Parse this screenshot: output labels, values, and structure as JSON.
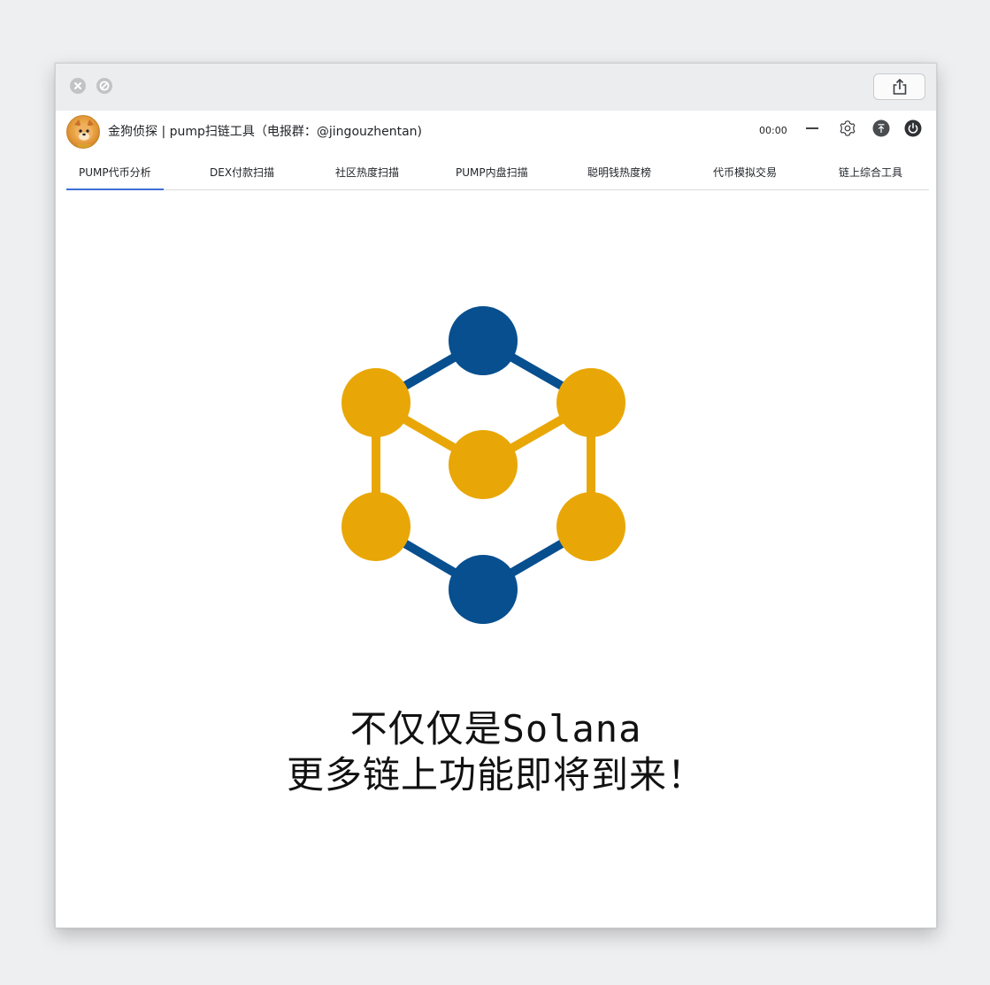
{
  "app": {
    "title": "金狗侦探 | pump扫链工具（电报群：@jingouzhentan)",
    "timer": "00:00"
  },
  "titlebar": {
    "close_icon": "close-icon",
    "minimize_icon": "disabled-icon",
    "share_icon": "share-icon"
  },
  "toolbar": {
    "minimize_icon": "minus-icon",
    "settings_icon": "gear-icon",
    "pin_icon": "pin-top-icon",
    "power_icon": "power-icon"
  },
  "tabs": [
    {
      "label": "PUMP代币分析",
      "active": true
    },
    {
      "label": "DEX付款扫描",
      "active": false
    },
    {
      "label": "社区热度扫描",
      "active": false
    },
    {
      "label": "PUMP内盘扫描",
      "active": false
    },
    {
      "label": "聪明钱热度榜",
      "active": false
    },
    {
      "label": "代币模拟交易",
      "active": false
    },
    {
      "label": "链上综合工具",
      "active": false
    }
  ],
  "main": {
    "line1": "不仅仅是Solana",
    "line2": "更多链上功能即将到来！",
    "logo_icon": "network-cube-icon"
  },
  "colors": {
    "accent": "#3e70d6",
    "node_blue": "#074f8f",
    "node_gold": "#e8a707",
    "titlebar_bg": "#ecedef",
    "page_bg": "#eeeff1"
  }
}
